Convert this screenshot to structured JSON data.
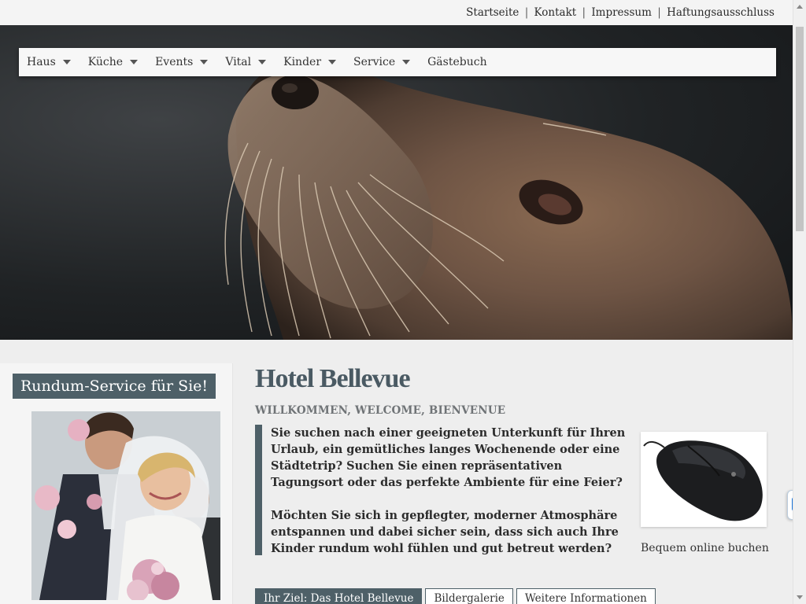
{
  "top_links": [
    {
      "label": "Startseite"
    },
    {
      "label": "Kontakt"
    },
    {
      "label": "Impressum"
    },
    {
      "label": "Haftungsausschluss"
    }
  ],
  "top_separator": "|",
  "nav": [
    {
      "label": "Haus",
      "has_dropdown": true
    },
    {
      "label": "Küche",
      "has_dropdown": true
    },
    {
      "label": "Events",
      "has_dropdown": true
    },
    {
      "label": "Vital",
      "has_dropdown": true
    },
    {
      "label": "Kinder",
      "has_dropdown": true
    },
    {
      "label": "Service",
      "has_dropdown": true
    },
    {
      "label": "Gästebuch",
      "has_dropdown": false
    }
  ],
  "sidebar": {
    "title": "Rundum-Service für Sie!"
  },
  "main": {
    "title": "Hotel Bellevue",
    "subtitle": "WILLKOMMEN, WELCOME, BIENVENUE",
    "paragraph1": "Sie suchen nach einer geeigneten Unterkunft für Ihren Urlaub, ein gemütliches langes Wochenende oder eine Städtetrip? Suchen Sie einen repräsentativen Tagungsort oder das perfekte Ambiente für eine Feier?",
    "paragraph2": "Möchten Sie sich in gepflegter, moderner Atmosphäre entspannen und dabei sicher sein, dass sich auch Ihre Kinder rundum wohl fühlen und gut betreut werden?",
    "booking_caption": "Bequem online buchen"
  },
  "tabs": [
    {
      "label": "Ihr Ziel: Das Hotel Bellevue",
      "active": true
    },
    {
      "label": "Bildergalerie",
      "active": false
    },
    {
      "label": "Weitere Informationen",
      "active": false
    }
  ],
  "colors": {
    "accent": "#4e6068",
    "page_background": "#eeeeee"
  },
  "icons": {
    "nav_dropdown": "caret-down-icon",
    "side_widget": "teamviewer-icon"
  }
}
